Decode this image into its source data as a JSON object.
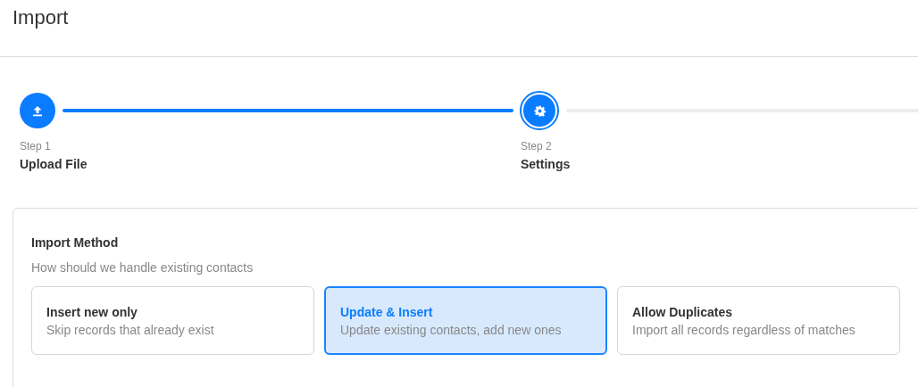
{
  "page": {
    "title": "Import"
  },
  "steps": [
    {
      "number": "Step 1",
      "label": "Upload File",
      "completed": true,
      "current": false
    },
    {
      "number": "Step 2",
      "label": "Settings",
      "completed": false,
      "current": true
    }
  ],
  "section": {
    "title": "Import Method",
    "subtitle": "How should we handle existing contacts",
    "options": [
      {
        "title": "Insert new only",
        "description": "Skip records that already exist",
        "selected": false
      },
      {
        "title": "Update & Insert",
        "description": "Update existing contacts, add new ones",
        "selected": true
      },
      {
        "title": "Allow Duplicates",
        "description": "Import all records regardless of matches",
        "selected": false
      }
    ]
  }
}
